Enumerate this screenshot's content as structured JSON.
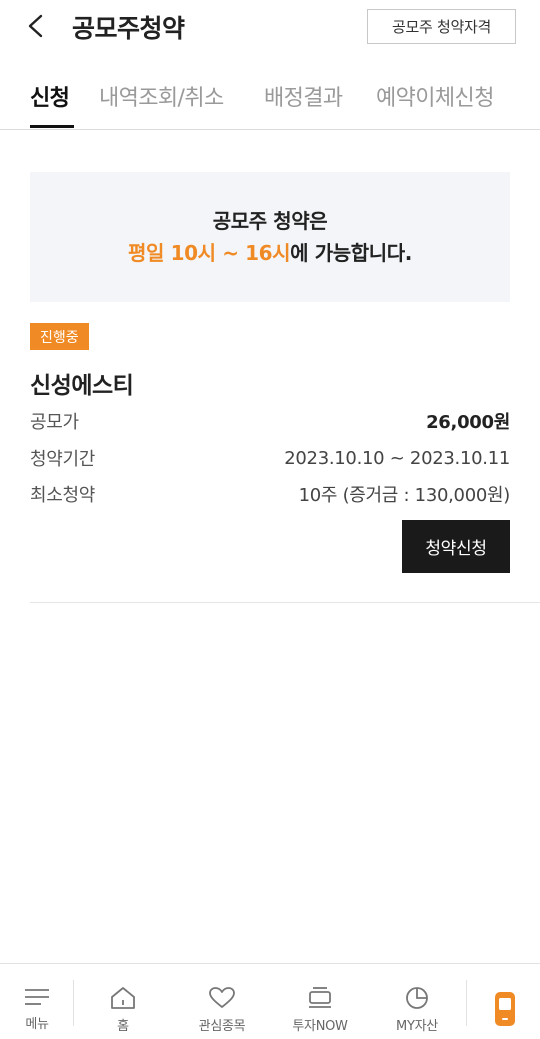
{
  "header": {
    "title": "공모주청약",
    "qualification_button": "공모주 청약자격"
  },
  "tabs": [
    {
      "label": "신청",
      "active": true
    },
    {
      "label": "내역조회/취소",
      "active": false
    },
    {
      "label": "배정결과",
      "active": false
    },
    {
      "label": "예약이체신청",
      "active": false
    }
  ],
  "notice": {
    "line1": "공모주 청약은",
    "line2_highlight": "평일 10시 ~ 16시",
    "line2_rest": "에 가능합니다."
  },
  "offering": {
    "status_badge": "진행중",
    "name": "신성에스티",
    "rows": [
      {
        "label": "공모가",
        "value": "26,000원"
      },
      {
        "label": "청약기간",
        "value": "2023.10.10 ~ 2023.10.11"
      },
      {
        "label": "최소청약",
        "value": "10주 (증거금 : 130,000원)"
      }
    ],
    "apply_button": "청약신청"
  },
  "bottom_nav": [
    {
      "label": "메뉴",
      "icon": "menu-icon"
    },
    {
      "label": "홈",
      "icon": "home-icon"
    },
    {
      "label": "관심종목",
      "icon": "heart-icon"
    },
    {
      "label": "투자NOW",
      "icon": "now-icon"
    },
    {
      "label": "MY자산",
      "icon": "pie-chart-icon"
    },
    {
      "label": "",
      "icon": "phone-icon"
    }
  ],
  "colors": {
    "accent": "#f08a24",
    "dark_button": "#1a1a1a",
    "notice_bg": "#f3f5f8"
  }
}
